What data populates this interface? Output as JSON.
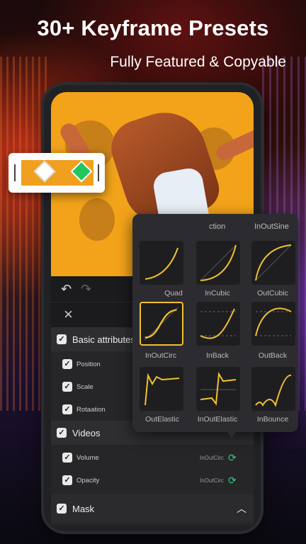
{
  "headline": "30+ Keyframe Presets",
  "subline": "Fully Featured & Copyable",
  "colors": {
    "accent": "#f0c030",
    "keyframe": "#2fd07a",
    "preview_bg": "#f2a31a"
  },
  "toolbar": {
    "undo_icon": "undo-icon",
    "redo_icon": "redo-icon",
    "close_icon": "close-icon"
  },
  "attributes": {
    "basic": {
      "label": "Basic attributes",
      "items": [
        {
          "label": "Position"
        },
        {
          "label": "Scale"
        },
        {
          "label": "Rotaation"
        }
      ]
    },
    "videos": {
      "label": "Videos",
      "items": [
        {
          "label": "Volume",
          "ease": "InOutCirc"
        },
        {
          "label": "Opacity",
          "ease": "InOutCirc"
        }
      ]
    },
    "mask": {
      "label": "Mask"
    }
  },
  "presets": {
    "header_partial": "ction",
    "header_right": "InOutSine",
    "items": [
      {
        "label": "Quad",
        "partial": true
      },
      {
        "label": "InCubic"
      },
      {
        "label": "OutCubic"
      },
      {
        "label": "InOutCirc",
        "selected": true
      },
      {
        "label": "InBack"
      },
      {
        "label": "OutBack"
      },
      {
        "label": "OutElastic"
      },
      {
        "label": "InOutElastic"
      },
      {
        "label": "InBounce"
      }
    ]
  }
}
